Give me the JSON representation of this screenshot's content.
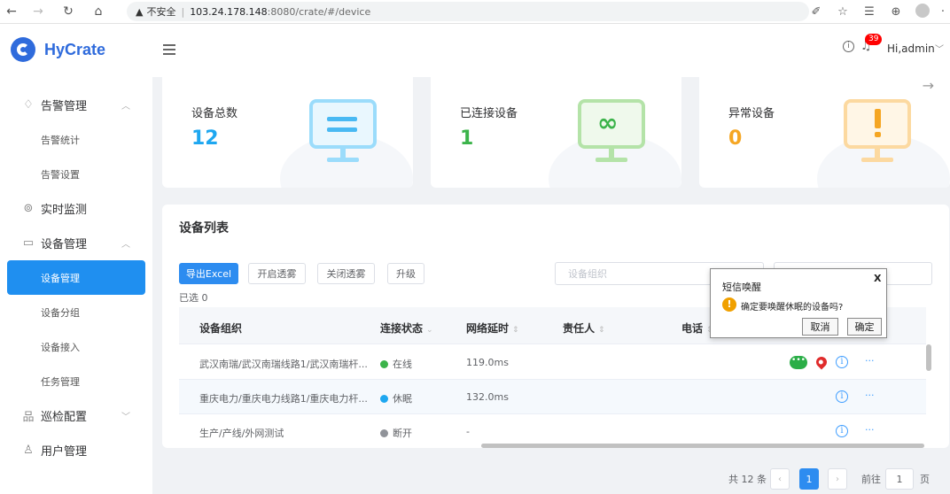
{
  "browser": {
    "security_label": "不安全",
    "url_host": "103.24.178.148",
    "url_rest": ":8080/crate/#/device"
  },
  "app": {
    "name": "HyCrate"
  },
  "sidebar": {
    "items": [
      {
        "label": "告警管理"
      },
      {
        "label": "告警统计"
      },
      {
        "label": "告警设置"
      },
      {
        "label": "实时监测"
      },
      {
        "label": "设备管理"
      },
      {
        "label": "设备管理"
      },
      {
        "label": "设备分组"
      },
      {
        "label": "设备接入"
      },
      {
        "label": "任务管理"
      },
      {
        "label": "巡检配置"
      },
      {
        "label": "用户管理"
      }
    ]
  },
  "header": {
    "notifications": "39",
    "user": "Hi,admin"
  },
  "stats": [
    {
      "label": "设备总数",
      "value": "12",
      "color": "#1ea7f0"
    },
    {
      "label": "已连接设备",
      "value": "1",
      "color": "#3bb34a"
    },
    {
      "label": "异常设备",
      "value": "0",
      "color": "#f5a623"
    }
  ],
  "device_list": {
    "title": "设备列表",
    "buttons": {
      "export": "导出Excel",
      "open_fog": "开启透雾",
      "close_fog": "关闭透雾",
      "upgrade": "升级"
    },
    "filter_placeholder": "设备组织",
    "selected": "已选 0",
    "columns": [
      "设备组织",
      "连接状态",
      "网络延时",
      "责任人",
      "电话"
    ],
    "rows": [
      {
        "org": "武汉南瑞/武汉南瑞线路1/武汉南瑞杆...",
        "status": "在线",
        "status_color": "#3bb34a",
        "latency": "119.0ms"
      },
      {
        "org": "重庆电力/重庆电力线路1/重庆电力杆...",
        "status": "休眠",
        "status_color": "#1ea7f0",
        "latency": "132.0ms"
      },
      {
        "org": "生产/产线/外网测试",
        "status": "断开",
        "status_color": "#909399",
        "latency": "-"
      }
    ]
  },
  "popup": {
    "title": "短信唤醒",
    "close": "X",
    "message": "确定要唤醒休眠的设备吗?",
    "cancel": "取消",
    "confirm": "确定"
  },
  "pagination": {
    "total": "共 12 条",
    "current": "1",
    "goto_label": "前往",
    "goto_value": "1",
    "page_suffix": "页"
  }
}
